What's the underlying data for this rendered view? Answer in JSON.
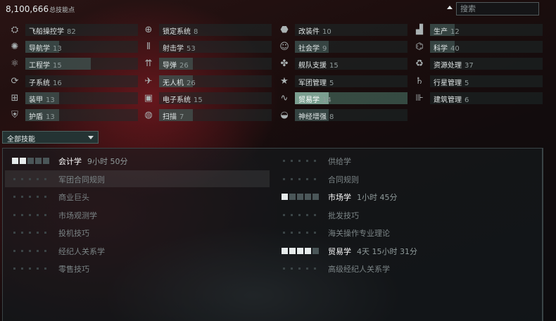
{
  "header": {
    "sp_total": "8,100,666",
    "sp_suffix": "总技能点",
    "search_placeholder": "搜索"
  },
  "categories": [
    {
      "icon": "spaceship-command-icon",
      "name": "飞船操控学",
      "count": "82",
      "progress": 0.0
    },
    {
      "icon": "targeting-icon",
      "name": "锁定系统",
      "count": "8",
      "progress": 0.0
    },
    {
      "icon": "rigging-icon",
      "name": "改装件",
      "count": "10",
      "progress": 0.0
    },
    {
      "icon": "production-icon",
      "name": "生产",
      "count": "12",
      "progress": 0.22
    },
    {
      "icon": "navigation-icon",
      "name": "导航学",
      "count": "13",
      "progress": 0.3
    },
    {
      "icon": "gunnery-icon",
      "name": "射击学",
      "count": "53",
      "progress": 0.0
    },
    {
      "icon": "social-icon",
      "name": "社会学",
      "count": "9",
      "progress": 0.3
    },
    {
      "icon": "science-icon",
      "name": "科学",
      "count": "40",
      "progress": 0.22
    },
    {
      "icon": "engineering-icon",
      "name": "工程学",
      "count": "15",
      "progress": 0.58
    },
    {
      "icon": "missiles-icon",
      "name": "导弹",
      "count": "26",
      "progress": 0.3
    },
    {
      "icon": "fleet-support-icon",
      "name": "舰队支援",
      "count": "15",
      "progress": 0.0
    },
    {
      "icon": "resource-processing-icon",
      "name": "资源处理",
      "count": "37",
      "progress": 0.0
    },
    {
      "icon": "subsystems-icon",
      "name": "子系统",
      "count": "16",
      "progress": 0.0
    },
    {
      "icon": "drones-icon",
      "name": "无人机",
      "count": "26",
      "progress": 0.3
    },
    {
      "icon": "corporation-management-icon",
      "name": "军团管理",
      "count": "5",
      "progress": 0.0
    },
    {
      "icon": "planet-management-icon",
      "name": "行星管理",
      "count": "5",
      "progress": 0.0
    },
    {
      "icon": "armor-icon",
      "name": "装甲",
      "count": "13",
      "progress": 0.3
    },
    {
      "icon": "electronic-systems-icon",
      "name": "电子系统",
      "count": "15",
      "progress": 0.0
    },
    {
      "icon": "trade-icon",
      "name": "贸易学",
      "count": "14",
      "progress": 0.3,
      "selected": true
    },
    {
      "icon": "structure-management-icon",
      "name": "建筑管理",
      "count": "6",
      "progress": 0.0
    },
    {
      "icon": "shields-icon",
      "name": "护盾",
      "count": "13",
      "progress": 0.3
    },
    {
      "icon": "scanning-icon",
      "name": "扫描",
      "count": "7",
      "progress": 0.3
    },
    {
      "icon": "neural-enhancement-icon",
      "name": "神经增强",
      "count": "8",
      "progress": 0.3
    }
  ],
  "filter": {
    "selected": "全部技能"
  },
  "skills": [
    {
      "name": "会计学",
      "level": 2,
      "time": "9小时 50分",
      "trained": true
    },
    {
      "name": "供给学",
      "level": 0,
      "time": "",
      "trained": false
    },
    {
      "name": "军团合同规则",
      "level": 0,
      "time": "",
      "trained": false,
      "highlighted": true
    },
    {
      "name": "合同规则",
      "level": 0,
      "time": "",
      "trained": false
    },
    {
      "name": "商业巨头",
      "level": 0,
      "time": "",
      "trained": false
    },
    {
      "name": "市场学",
      "level": 1,
      "time": "1小时 45分",
      "trained": true
    },
    {
      "name": "市场观测学",
      "level": 0,
      "time": "",
      "trained": false
    },
    {
      "name": "批发技巧",
      "level": 0,
      "time": "",
      "trained": false
    },
    {
      "name": "投机技巧",
      "level": 0,
      "time": "",
      "trained": false
    },
    {
      "name": "海关操作专业理论",
      "level": 0,
      "time": "",
      "trained": false
    },
    {
      "name": "经纪人关系学",
      "level": 0,
      "time": "",
      "trained": false
    },
    {
      "name": "贸易学",
      "level": 4,
      "time": "4天 15小时 31分",
      "trained": true
    },
    {
      "name": "零售技巧",
      "level": 0,
      "time": "",
      "trained": false
    },
    {
      "name": "高级经纪人关系学",
      "level": 0,
      "time": "",
      "trained": false
    }
  ]
}
